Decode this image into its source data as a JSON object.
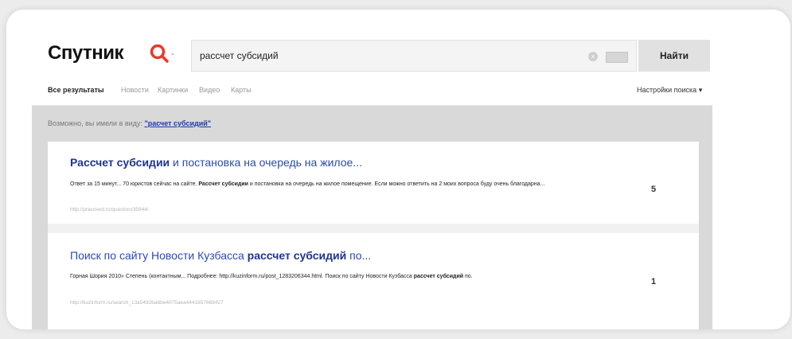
{
  "logo": {
    "text": "Спутник"
  },
  "search": {
    "query": "рассчет субсидий",
    "button_label": "Найти"
  },
  "tabs": [
    {
      "label": "Все результаты",
      "active": true
    },
    {
      "label": "Новости"
    },
    {
      "label": "Картинки"
    },
    {
      "label": "Видео"
    },
    {
      "label": "Карты"
    }
  ],
  "settings": {
    "label": "Настройки поиска",
    "chevron": "▾"
  },
  "suggestion": {
    "prefix": "Возможно, вы имели в виду:",
    "link": "\"расчет субсидий\""
  },
  "results": [
    {
      "title_bold": "Рассчет субсидии",
      "title_rest": " и постановка на очередь на жилое...",
      "snippet_pre": "Ответ за 15 минут... 70 юристов сейчас на сайте. ",
      "snippet_bold1": "Рассчет субсидии",
      "snippet_post": " и постановка на очередь на жилое помещение. Если можно ответить на 2 моих вопроса буду очень благодарна...",
      "url": "http://pravoved.ru/question/35944/",
      "count": "5"
    },
    {
      "title_pre": "Поиск по сайту Новости Кузбасса ",
      "title_bold": "рассчет субсидий",
      "title_rest": " по...",
      "snippet_pre": "Горная Шория 2010» Степень (контактным... Подробнее: http://kuzinform.ru/post_1283206344.html. Поиск по сайту Новости Кузбасса ",
      "snippet_bold1": "рассчет субсидий",
      "snippet_post": " по.",
      "url": "http://kuzinform.ru/search_13a5492ba6be4075aea4441657668427",
      "count": "1"
    }
  ],
  "colors": {
    "accent": "#e8392c",
    "link": "#2a4bb0",
    "link_dark": "#1d3590"
  },
  "icons": {
    "logo": "magnifier-logo-icon",
    "clear": "clear-icon",
    "keyboard": "keyboard-icon"
  }
}
